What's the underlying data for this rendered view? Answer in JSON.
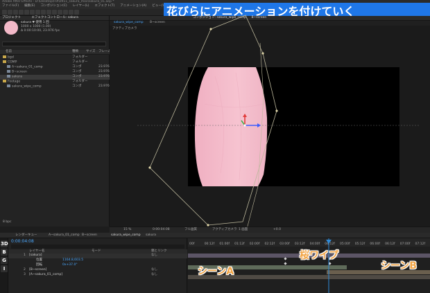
{
  "app": {
    "title": "Adobe After Effects - D:\\Desktop\\FIX\\0911_sakura_mov\\sakura_01.aep *"
  },
  "banner": {
    "text": "花びらにアニメーションを付けていく"
  },
  "menu": [
    "ファイル(F)",
    "編集(E)",
    "コンポジション(C)",
    "レイヤー(L)",
    "エフェクト(T)",
    "アニメーション(A)",
    "ビュー(V)",
    "ウィンドウ(W)",
    "ヘルプ(H)"
  ],
  "project": {
    "tabs": [
      "プロジェクト",
      "エフェクトコントロール: sakura"
    ],
    "item_name": "sakura ▼ 使用 1 回",
    "item_info1": "1000 x 1000 (1.00)",
    "item_info2": "Δ 0:00:10:00, 23.976 fps",
    "columns": {
      "name": "名前",
      "type": "種類",
      "size": "サイズ",
      "fps": "フレームレ"
    },
    "files": [
      {
        "name": "bgcl",
        "type": "フォルダー",
        "size": "",
        "kind": "folder"
      },
      {
        "name": "COMP",
        "type": "フォルダー",
        "size": "",
        "kind": "folder"
      },
      {
        "name": "A~sakura_01_comp",
        "type": "コンポ",
        "size": "",
        "fps": "23.976",
        "kind": "comp"
      },
      {
        "name": "B~screen",
        "type": "コンポ",
        "size": "",
        "fps": "23.976",
        "kind": "comp"
      },
      {
        "name": "sakura",
        "type": "コンポ",
        "size": "",
        "fps": "23.976",
        "kind": "comp",
        "selected": true
      },
      {
        "name": "Footage",
        "type": "フォルダー",
        "size": "",
        "kind": "folder"
      },
      {
        "name": "sakura_wipe_comp",
        "type": "コンポ",
        "size": "",
        "fps": "23.976",
        "kind": "comp"
      }
    ],
    "footer": "8 bpc"
  },
  "viewer": {
    "tabs": [
      "コンポジション: sakura_wipe_comp",
      "B~screen"
    ],
    "subtabs": [
      "sakura_wipe_comp",
      "B~screen"
    ],
    "label": "アクティブカメラ",
    "zoom": "15 %",
    "timecode": "0:00:04:08",
    "quality": "フル画質",
    "camera": "アクティブカメラ",
    "views": "1 画面",
    "offset": "+0.0"
  },
  "timeline": {
    "tabs": [
      "レンダーキュー",
      "A~sakura_01_comp",
      "B~screen",
      "sakura_wipe_comp",
      "sakura"
    ],
    "timecode": "0:00:04:08",
    "col_layer": "レイヤー名",
    "col_parent": "親とリンク",
    "col_mode": "モード",
    "layers": [
      {
        "num": "1",
        "name": "[sakura]",
        "parent": "なし"
      },
      {
        "num": "",
        "name": "位置",
        "value": "1164.8,603.5"
      },
      {
        "num": "",
        "name": "回転",
        "value": "0x+37.0°"
      },
      {
        "num": "2",
        "name": "[B~screen]",
        "parent": "なし"
      },
      {
        "num": "3",
        "name": "[A~sakura_01_comp]",
        "parent": "なし"
      }
    ],
    "ruler": [
      "00f",
      "00:12f",
      "01:00f",
      "01:12f",
      "02:00f",
      "02:12f",
      "03:00f",
      "03:12f",
      "04:00f",
      "04:12f",
      "05:00f",
      "05:12f",
      "06:00f",
      "06:12f",
      "07:00f",
      "07:12f"
    ],
    "side_buttons": [
      "3D",
      "B",
      "G",
      "I"
    ]
  },
  "callouts": {
    "wipe": "桜ワイプ",
    "sceneA": "シーンA",
    "sceneB": "シーンB"
  },
  "colors": {
    "banner": "#1f77e8",
    "callout": "#f2a444",
    "petal": "#f3b9c8",
    "playhead": "#2f8bd9"
  }
}
